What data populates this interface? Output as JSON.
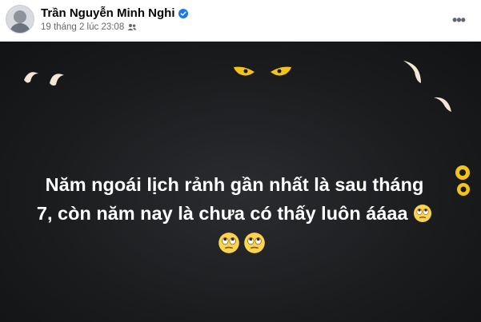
{
  "post": {
    "author": "Trần Nguyễn Minh Nghi",
    "timestamp": "19 tháng 2 lúc 23:08",
    "audience_icon": "friends-icon",
    "verified_icon": "verified-badge-icon",
    "more_label": "•••",
    "text_line1": "Năm ngoái lịch rảnh gần nhất là sau tháng",
    "text_line2": "7, còn năm nay là chưa có thấy luôn ááaa",
    "background_theme": "dark-eyes",
    "emoji": "face-with-rolling-eyes",
    "colors": {
      "verified": "#1877f2",
      "background": "#1c1d1f",
      "eyes_yellow": "#f3c21b",
      "eyes_cream": "#f3e6d4"
    }
  }
}
